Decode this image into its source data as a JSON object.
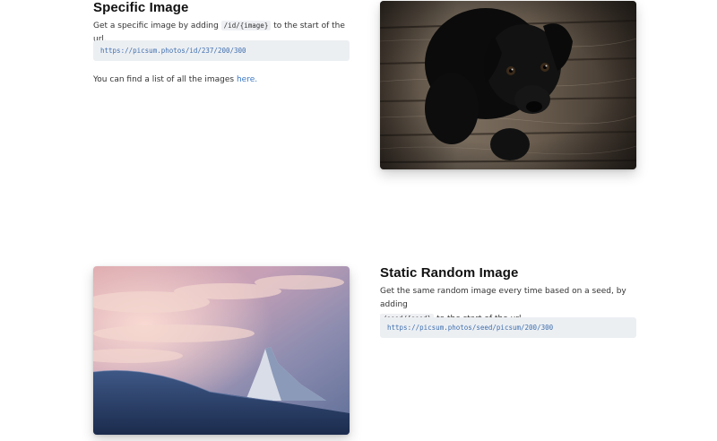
{
  "specific": {
    "title": "Specific Image",
    "desc_before": "Get a specific image by adding",
    "desc_code": "/id/{image}",
    "desc_after": "to the start of the url.",
    "url": "https://picsum.photos/id/237/200/300",
    "list_text": "You can find a list of all the images",
    "list_link": "here."
  },
  "static_random": {
    "title": "Static Random Image",
    "desc_before": "Get the same random image every time based on a seed, by adding",
    "desc_code": "/seed/{seed}",
    "desc_after": "to the start of the url.",
    "url": "https://picsum.photos/seed/picsum/200/300"
  },
  "colors": {
    "link": "#3b78c4",
    "code_text": "#3f6fb0",
    "code_bg": "#eceff2"
  }
}
